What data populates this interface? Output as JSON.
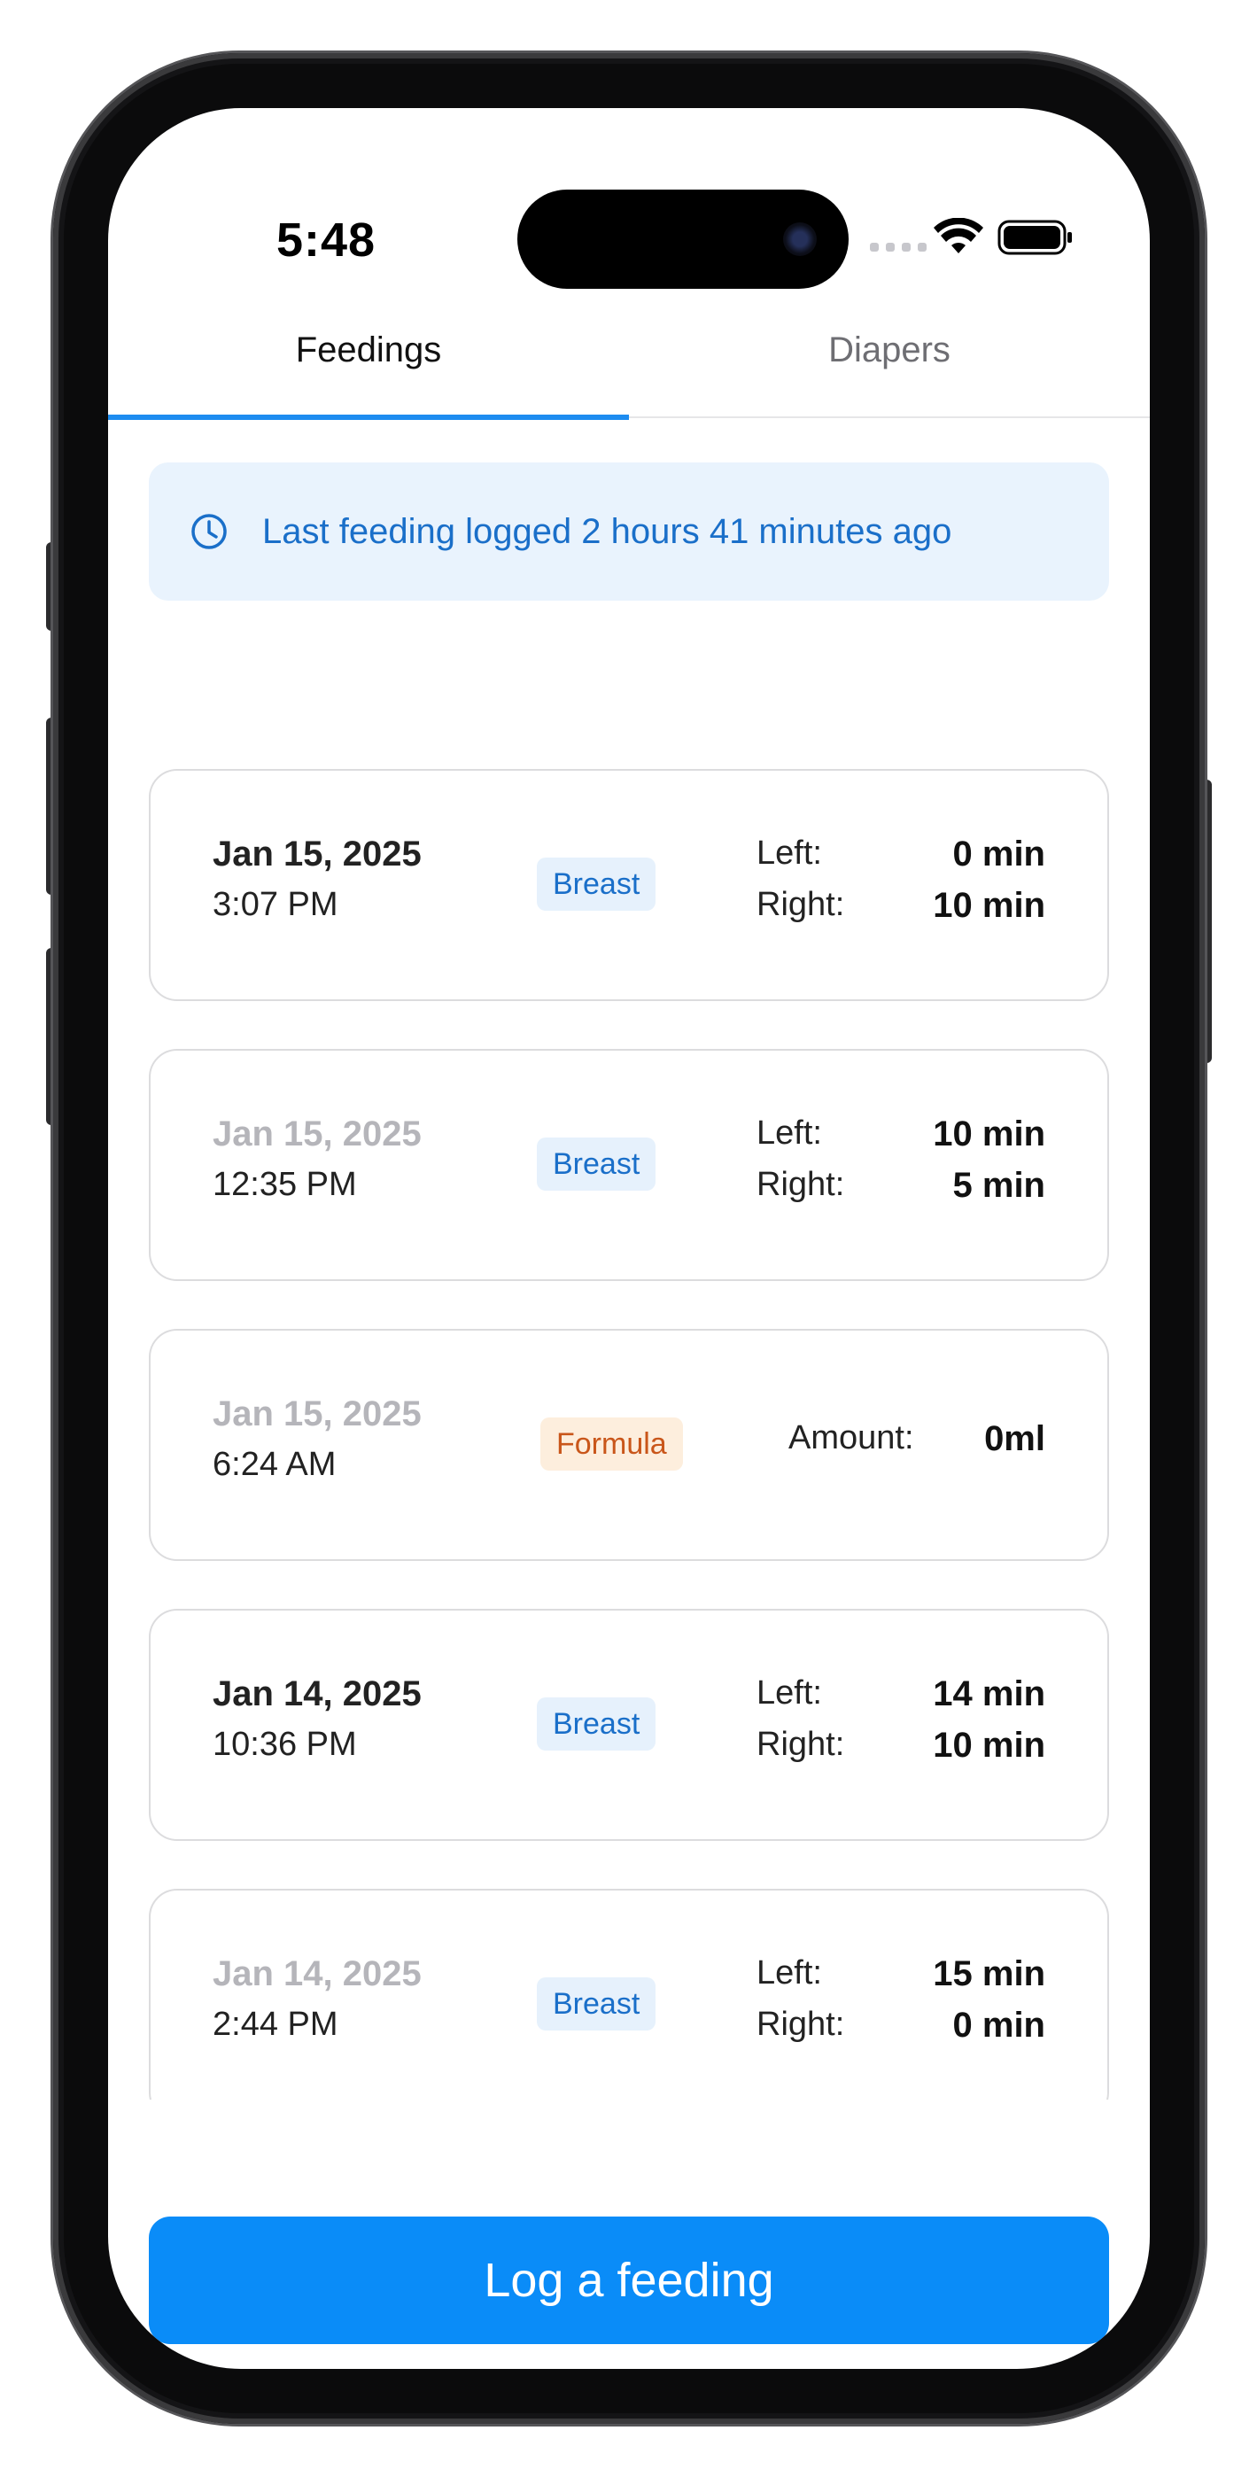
{
  "status_bar": {
    "time": "5:48"
  },
  "tabs": [
    {
      "label": "Feedings",
      "active": true
    },
    {
      "label": "Diapers",
      "active": false
    }
  ],
  "notice": {
    "text": "Last feeding logged 2 hours 41 minutes ago",
    "icon": "clock-icon"
  },
  "feedings": [
    {
      "date": "Jan 15, 2025",
      "time": "3:07 PM",
      "type": "Breast",
      "left_label": "Left:",
      "left": "0 min",
      "right_label": "Right:",
      "right": "10 min",
      "date_muted": false
    },
    {
      "date": "Jan 15, 2025",
      "time": "12:35 PM",
      "type": "Breast",
      "left_label": "Left:",
      "left": "10 min",
      "right_label": "Right:",
      "right": "5 min",
      "date_muted": true
    },
    {
      "date": "Jan 15, 2025",
      "time": "6:24 AM",
      "type": "Formula",
      "amount_label": "Amount:",
      "amount": "0ml",
      "date_muted": true
    },
    {
      "date": "Jan 14, 2025",
      "time": "10:36 PM",
      "type": "Breast",
      "left_label": "Left:",
      "left": "14 min",
      "right_label": "Right:",
      "right": "10 min",
      "date_muted": false
    },
    {
      "date": "Jan 14, 2025",
      "time": "2:44 PM",
      "type": "Breast",
      "left_label": "Left:",
      "left": "15 min",
      "right_label": "Right:",
      "right": "0 min",
      "date_muted": true
    }
  ],
  "log_button": {
    "label": "Log a feeding"
  },
  "colors": {
    "accent": "#0a8cf8",
    "notice_bg": "#e9f3fd",
    "breast_badge": "#1a6fc9",
    "formula_badge": "#c9561a"
  }
}
